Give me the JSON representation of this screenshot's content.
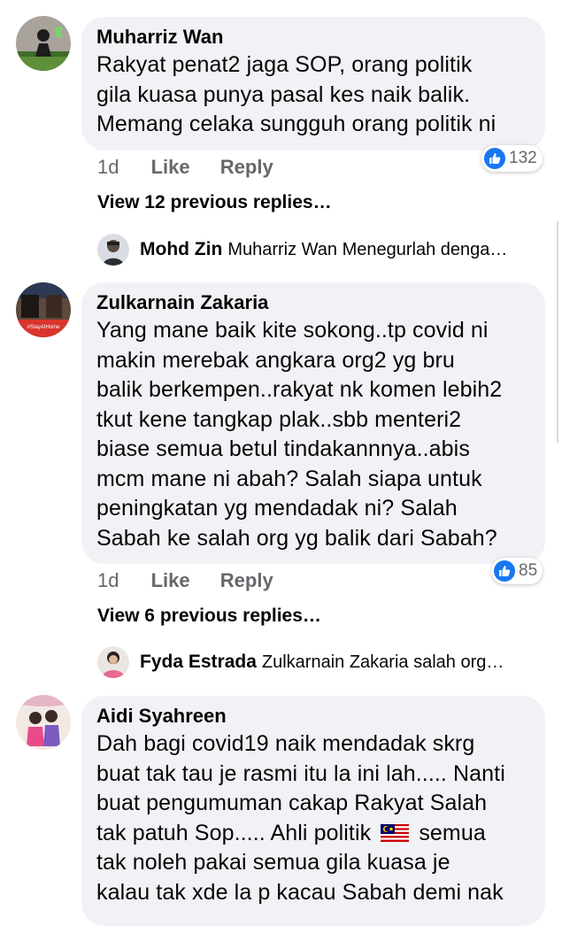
{
  "comments": [
    {
      "author": "Muharriz Wan",
      "lines": [
        "Rakyat penat2 jaga SOP, orang politik",
        "gila kuasa punya pasal kes naik balik.",
        "Memang celaka sungguh orang politik ni"
      ],
      "time": "1d",
      "like_label": "Like",
      "reply_label": "Reply",
      "reaction_count": "132",
      "view_replies": "View 12 previous replies…",
      "reply_preview": {
        "author": "Mohd Zin",
        "snippet": "Muharriz Wan Menegurlah denga…"
      }
    },
    {
      "author": "Zulkarnain Zakaria",
      "lines": [
        "Yang mane baik kite sokong..tp covid ni",
        "makin merebak angkara org2 yg bru",
        "balik berkempen..rakyat nk komen lebih2",
        "tkut kene tangkap plak..sbb menteri2",
        "biase semua betul tindakannnya..abis",
        "mcm mane ni abah? Salah siapa untuk",
        "peningkatan yg mendadak ni? Salah",
        "Sabah ke salah org yg balik dari Sabah?"
      ],
      "time": "1d",
      "like_label": "Like",
      "reply_label": "Reply",
      "reaction_count": "85",
      "view_replies": "View 6 previous replies…",
      "reply_preview": {
        "author": "Fyda Estrada",
        "snippet": "Zulkarnain Zakaria salah org…"
      }
    },
    {
      "author": "Aidi Syahreen",
      "lines": [
        "Dah bagi covid19 naik mendadak skrg",
        "buat tak tau je rasmi itu la ini lah..... Nanti",
        "buat pengumuman cakap Rakyat Salah",
        "tak patuh Sop..... Ahli politik",
        "tak noleh pakai semua gila kuasa je",
        "kalau tak xde la p kacau Sabah demi nak"
      ],
      "line4_suffix": "semua"
    }
  ],
  "avatar_text": "#StayAtHome",
  "icons": {
    "like": "thumbs-up-icon",
    "flag": "malaysia-flag-icon"
  },
  "colors": {
    "bubble": "#f0f2f5",
    "like_blue": "#1877f2",
    "meta_gray": "#65676b"
  }
}
